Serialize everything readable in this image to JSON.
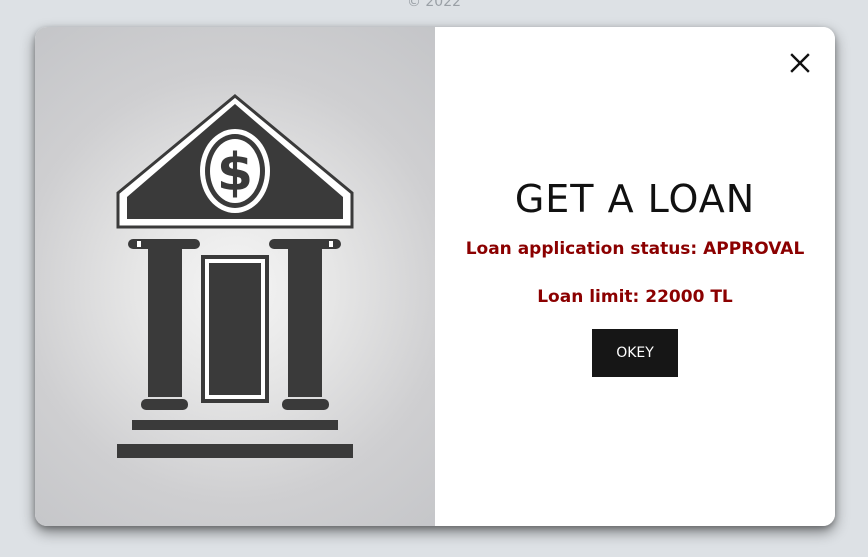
{
  "page": {
    "copyright": "© 2022"
  },
  "modal": {
    "image_icon": "bank-building-dollar-icon",
    "close_icon": "close-icon",
    "title": "GET A LOAN",
    "status_text": "Loan application status: APPROVAL",
    "limit_text": "Loan limit: 22000 TL",
    "okey_label": "OKEY"
  },
  "colors": {
    "page_background": "#dde1e5",
    "status_text": "#8b0000",
    "button_background": "#161616",
    "bank_icon": "#3a3a3a"
  }
}
